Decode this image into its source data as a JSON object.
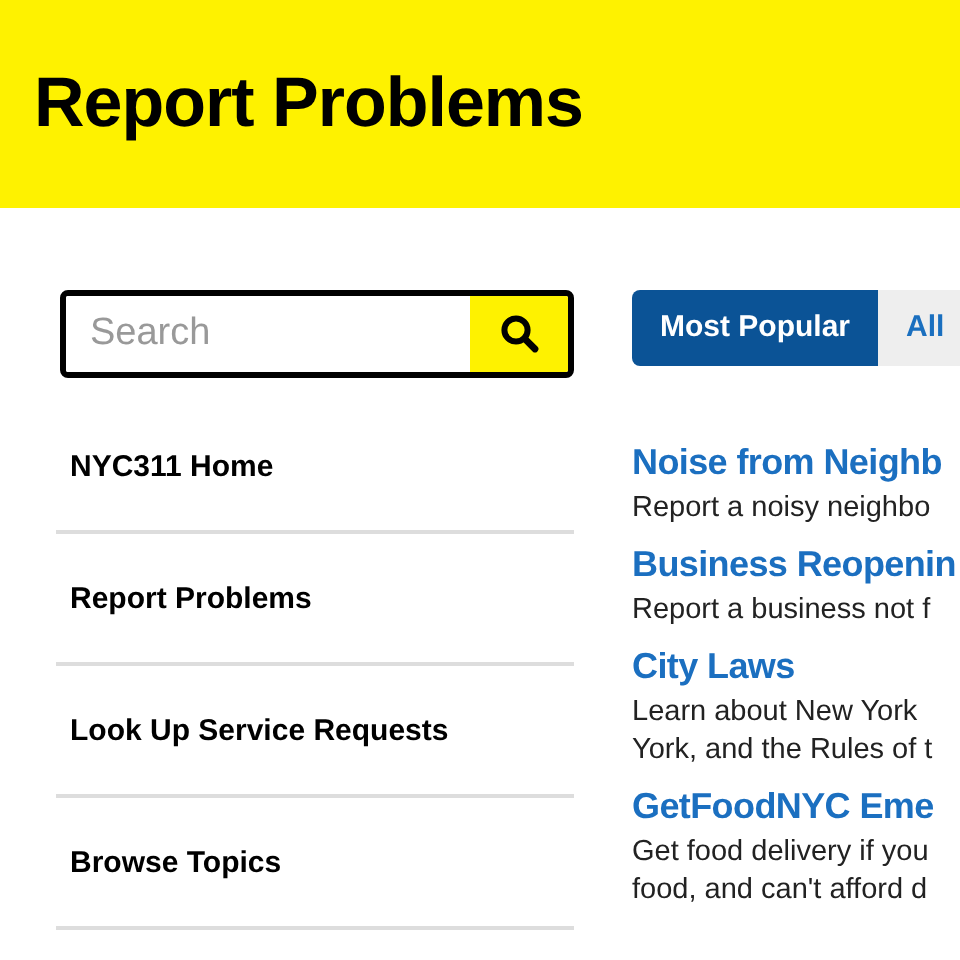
{
  "header": {
    "title": "Report Problems"
  },
  "search": {
    "placeholder": "Search"
  },
  "nav": [
    {
      "label": "NYC311 Home"
    },
    {
      "label": "Report Problems"
    },
    {
      "label": "Look Up Service Requests"
    },
    {
      "label": "Browse Topics"
    }
  ],
  "tabs": [
    {
      "label": "Most Popular",
      "selected": true
    },
    {
      "label": "All",
      "selected": false
    }
  ],
  "items": [
    {
      "title": "Noise from Neighb",
      "lines": [
        "Report a noisy neighbo"
      ]
    },
    {
      "title": "Business Reopenin",
      "lines": [
        "Report a business not f"
      ]
    },
    {
      "title": "City Laws",
      "lines": [
        "Learn about New York",
        "York, and the Rules of t"
      ]
    },
    {
      "title": "GetFoodNYC Eme",
      "lines": [
        "Get food delivery if you",
        "food, and can't afford d"
      ]
    }
  ]
}
